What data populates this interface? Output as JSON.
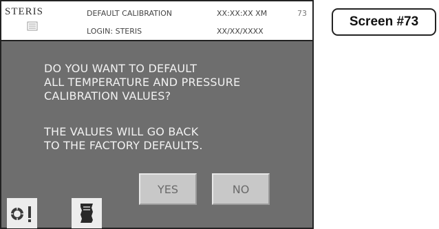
{
  "header": {
    "brand": "STERIS",
    "title": "DEFAULT CALIBRATION",
    "login": "LOGIN: STERIS",
    "time": "XX:XX:XX XM",
    "date": "XX/XX/XXXX",
    "screen_number": "73"
  },
  "dialog": {
    "question_lines": [
      "DO YOU WANT TO DEFAULT",
      "ALL TEMPERATURE AND PRESSURE",
      "CALIBRATION VALUES?"
    ],
    "note_lines": [
      "THE VALUES WILL GO BACK",
      "TO THE FACTORY DEFAULTS."
    ],
    "yes_label": "YES",
    "no_label": "NO"
  },
  "toolbar": {
    "icons": [
      "calibration-gauge-icon",
      "document-icon"
    ]
  },
  "caption": {
    "label": "Screen #73"
  },
  "colors": {
    "screen_background": "#6e6e6e",
    "header_background": "#ffffff",
    "button_face": "#c8c8c8",
    "dialog_text": "#f2f2f2"
  }
}
